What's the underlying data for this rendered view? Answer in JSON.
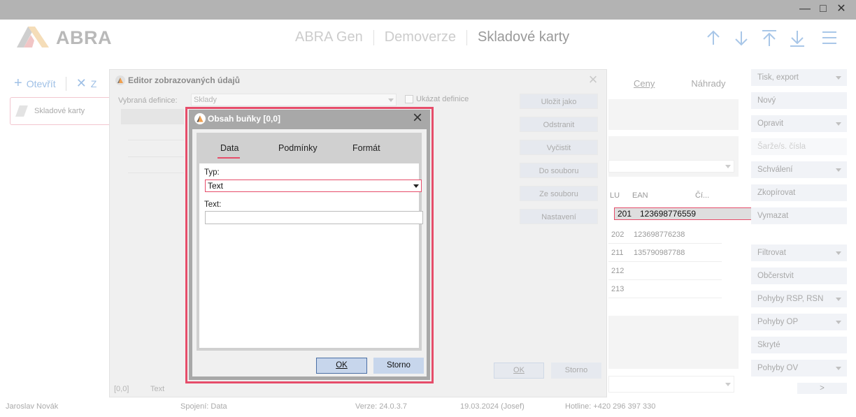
{
  "window": {
    "minimize": "—",
    "maximize": "□",
    "close": "✕"
  },
  "app": {
    "logo_text": "ABRA"
  },
  "breadcrumb": [
    "ABRA Gen",
    "Demoverze",
    "Skladové karty"
  ],
  "toolbar": {
    "open_label": "Otevřít",
    "close_label": "Z"
  },
  "open_tab": {
    "label": "Skladové karty"
  },
  "background_tabs": [
    "Ceny",
    "Náhrady"
  ],
  "grid": {
    "headers": [
      "LU",
      "EAN",
      "Čí..."
    ],
    "rows": [
      {
        "code": "201",
        "ean": "123698776559"
      },
      {
        "code": "202",
        "ean": "123698776238"
      },
      {
        "code": "211",
        "ean": "135790987788"
      },
      {
        "code": "212",
        "ean": ""
      },
      {
        "code": "213",
        "ean": ""
      }
    ]
  },
  "right_buttons": [
    {
      "label": "Tisk, export",
      "dropdown": true
    },
    {
      "label": "Nový",
      "dropdown": false
    },
    {
      "label": "Opravit",
      "dropdown": true
    },
    {
      "label": "Šarže/s. čísla",
      "dropdown": false,
      "disabled": true
    },
    {
      "label": "Schválení",
      "dropdown": true
    },
    {
      "label": "Zkopírovat",
      "dropdown": false
    },
    {
      "label": "Vymazat",
      "dropdown": false
    },
    {
      "label": "Filtrovat",
      "dropdown": true
    },
    {
      "label": "Občerstvit",
      "dropdown": false
    },
    {
      "label": "Pohyby RSP, RSN",
      "dropdown": true
    },
    {
      "label": "Pohyby OP",
      "dropdown": true
    },
    {
      "label": "Skryté",
      "dropdown": false
    },
    {
      "label": "Pohyby OV",
      "dropdown": true
    }
  ],
  "right_more": ">",
  "statusbar": {
    "user": "Jaroslav Novák",
    "connection": "Spojení: Data",
    "version": "Verze: 24.0.3.7",
    "date": "19.03.2024 (Josef)",
    "hotline": "Hotline: +420 296 397 330"
  },
  "editor": {
    "title": "Editor zobrazovaných údajů",
    "definition_label": "Vybraná definice:",
    "definition_value": "Sklady",
    "show_definition": "Ukázat definice",
    "buttons": [
      "Uložit jako",
      "Odstranit",
      "Vyčistit",
      "Do souboru",
      "Ze souboru",
      "Nastavení"
    ],
    "ok": "OK",
    "storno": "Storno",
    "status_cell": "[0,0]",
    "status_type": "Text"
  },
  "cell_dialog": {
    "title": "Obsah buňky [0,0]",
    "tabs": [
      "Data",
      "Podmínky",
      "Formát"
    ],
    "active_tab": "Data",
    "type_label": "Typ:",
    "type_value": "Text",
    "text_label": "Text:",
    "text_value": "",
    "ok": "OK",
    "storno": "Storno"
  },
  "colors": {
    "accent": "#e64d6a",
    "button": "#c7d6ec",
    "button_border": "#4b6fa5"
  },
  "icons": [
    "minimize-icon",
    "maximize-icon",
    "close-icon",
    "abra-logo-icon",
    "plus-icon",
    "x-icon",
    "arrow-up-icon",
    "arrow-down-icon",
    "arrow-top-icon",
    "arrow-bottom-icon",
    "hamburger-menu-icon",
    "chevron-down-icon"
  ]
}
